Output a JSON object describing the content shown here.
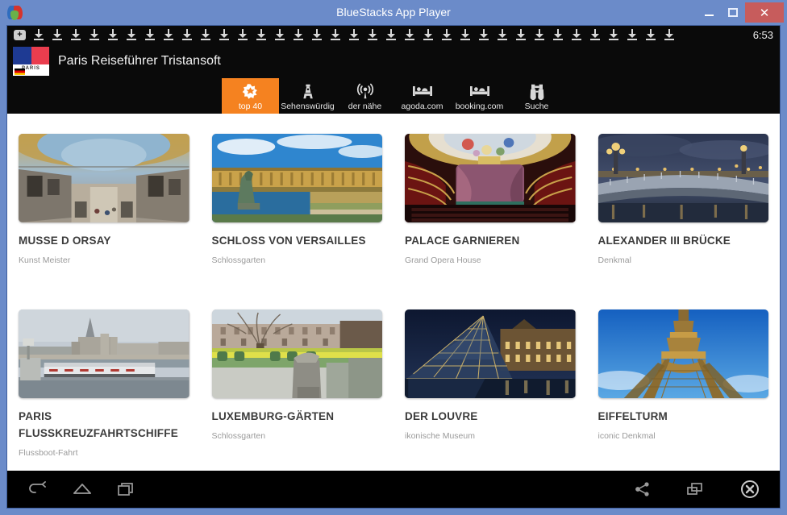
{
  "window": {
    "title": "BlueStacks App Player",
    "controls": {
      "minimize": "–",
      "maximize": "□",
      "close": "✕"
    }
  },
  "statusbar": {
    "download_badge": "+",
    "download_icon_count": 35,
    "time": "6:53"
  },
  "actionbar": {
    "title": "Paris Reiseführer Tristansoft",
    "logo_text": "PARIS"
  },
  "tabs": [
    {
      "label": "top 40",
      "icon": "star-badge-icon",
      "active": true
    },
    {
      "label": "Sehenswürdig",
      "icon": "tower-icon",
      "active": false
    },
    {
      "label": "der nähe",
      "icon": "signal-icon",
      "active": false
    },
    {
      "label": "agoda.com",
      "icon": "bed-icon",
      "active": false
    },
    {
      "label": "booking.com",
      "icon": "bed-icon",
      "active": false
    },
    {
      "label": "Suche",
      "icon": "binoculars-icon",
      "active": false
    }
  ],
  "cards": [
    {
      "title": "MUSSE D ORSAY",
      "subtitle": "Kunst Meister",
      "image": "musee-dorsay-interior"
    },
    {
      "title": "SCHLOSS VON VERSAILLES",
      "subtitle": "Schlossgarten",
      "image": "versailles-palace"
    },
    {
      "title": "PALACE GARNIEREN",
      "subtitle": "Grand Opera House",
      "image": "opera-garnier-interior"
    },
    {
      "title": "ALEXANDER III BRÜCKE",
      "subtitle": "Denkmal",
      "image": "pont-alexandre-iii"
    },
    {
      "title": "PARIS FLUSSKREUZFAHRTSCHIFFE",
      "subtitle": "Flussboot-Fahrt",
      "image": "seine-river-cruise"
    },
    {
      "title": "LUXEMBURG-GÄRTEN",
      "subtitle": "Schlossgarten",
      "image": "luxembourg-gardens"
    },
    {
      "title": "DER LOUVRE",
      "subtitle": "ikonische Museum",
      "image": "louvre-pyramid"
    },
    {
      "title": "EIFFELTURM",
      "subtitle": "iconic Denkmal",
      "image": "eiffel-tower"
    }
  ],
  "navbar": {
    "left": [
      {
        "name": "back-icon"
      },
      {
        "name": "home-icon"
      },
      {
        "name": "recents-icon"
      }
    ],
    "right": [
      {
        "name": "share-icon"
      },
      {
        "name": "screenshot-icon"
      },
      {
        "name": "close-circle-icon"
      }
    ]
  },
  "colors": {
    "accent": "#f58220",
    "window_chrome": "#6b8bc9",
    "close_button": "#c75c5c",
    "app_background": "#0a0a0a",
    "content_background": "#ffffff"
  }
}
